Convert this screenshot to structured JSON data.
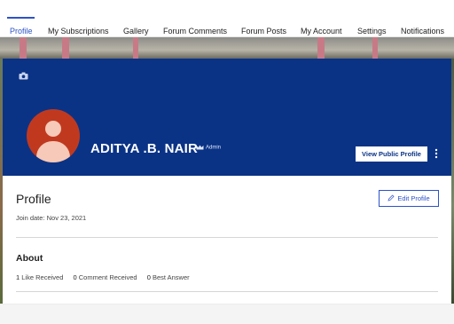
{
  "tabs": [
    {
      "label": "Profile",
      "active": true
    },
    {
      "label": "My Subscriptions",
      "active": false
    },
    {
      "label": "Gallery",
      "active": false
    },
    {
      "label": "Forum Comments",
      "active": false
    },
    {
      "label": "Forum Posts",
      "active": false
    },
    {
      "label": "My Account",
      "active": false
    },
    {
      "label": "Settings",
      "active": false
    },
    {
      "label": "Notifications",
      "active": false
    }
  ],
  "cover": {
    "name": "ADITYA .B. NAIR",
    "role": "Admin",
    "view_public_profile_label": "View Public Profile",
    "icons": [
      "camera-icon",
      "crown-icon",
      "more-vertical-icon",
      "avatar-placeholder"
    ]
  },
  "profile": {
    "title": "Profile",
    "join_date": "Join date: Nov 23, 2021",
    "edit_profile_label": "Edit Profile"
  },
  "about": {
    "title": "About",
    "stats": [
      {
        "count": "1",
        "label": "Like Received"
      },
      {
        "count": "0",
        "label": "Comment Received"
      },
      {
        "count": "0",
        "label": "Best Answer"
      }
    ]
  },
  "colors": {
    "accent": "#2d52c8",
    "cover_bg": "#0a3386",
    "avatar_bg": "#c0391f"
  }
}
